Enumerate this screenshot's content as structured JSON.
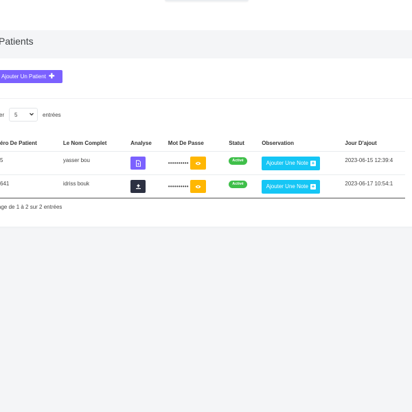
{
  "page": {
    "title": "Patients"
  },
  "toolbar": {
    "add_label": "Ajouter Un Patient",
    "add_icon": "plus-icon"
  },
  "length_menu": {
    "show_label": "er",
    "selected": "5",
    "entries_label": "entrées"
  },
  "table": {
    "headers": {
      "num": "éro De Patient",
      "name": "Le Nom Complet",
      "analyse": "Analyse",
      "password": "Mot De Passe",
      "status": "Statut",
      "observation": "Observation",
      "date": "Jour D'ajout"
    },
    "rows": [
      {
        "num": "5",
        "name": "yasser bou",
        "analyse_icon": "file-icon",
        "analyse_color": "#7b61ff",
        "password": "••••••••••",
        "status": "Activé",
        "observation_label": "Ajouter Une Note",
        "date": "2023-06-15 12:39:4"
      },
      {
        "num": "641",
        "name": "idriss bouk",
        "analyse_icon": "upload-icon",
        "analyse_color": "#2d3142",
        "password": "••••••••••",
        "status": "Activé",
        "observation_label": "Ajouter Une Note",
        "date": "2023-06-17 10:54:1"
      }
    ]
  },
  "footer": {
    "info": "age de 1 à 2 sur 2 entrées"
  },
  "colors": {
    "primary": "#7b61ff",
    "warning": "#ffb703",
    "info": "#15c6f5",
    "success": "#3fbf4a"
  }
}
